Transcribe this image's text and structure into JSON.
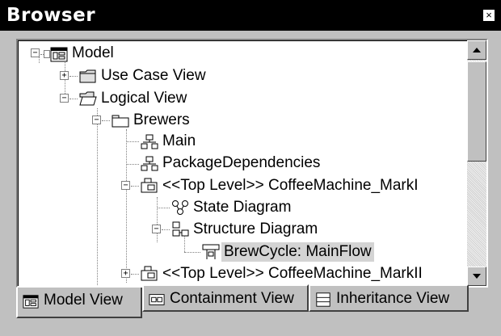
{
  "window": {
    "title": "Browser",
    "close_glyph": "×"
  },
  "tree": {
    "nodes": [
      {
        "label": "Model",
        "icon": "model-icon",
        "expanded": true
      },
      {
        "label": "Use Case View",
        "icon": "folder-closed-icon",
        "expanded": false
      },
      {
        "label": "Logical View",
        "icon": "folder-open-icon",
        "expanded": true
      },
      {
        "label": "Brewers",
        "icon": "package-folder-icon",
        "expanded": true
      },
      {
        "label": "Main",
        "icon": "class-diagram-icon"
      },
      {
        "label": "PackageDependencies",
        "icon": "class-diagram-icon"
      },
      {
        "label": "<<Top Level>> CoffeeMachine_MarkI",
        "icon": "capsule-icon",
        "expanded": true
      },
      {
        "label": "State Diagram",
        "icon": "state-diagram-icon"
      },
      {
        "label": "Structure Diagram",
        "icon": "structure-diagram-icon",
        "expanded": true
      },
      {
        "label": "BrewCycle: MainFlow",
        "icon": "capsule-role-icon",
        "selected": true
      },
      {
        "label": "<<Top Level>> CoffeeMachine_MarkII",
        "icon": "capsule-icon",
        "expanded": false
      }
    ]
  },
  "tabs": [
    {
      "label": "Model View",
      "icon": "model-view-icon",
      "active": true
    },
    {
      "label": "Containment View",
      "icon": "containment-view-icon",
      "active": false
    },
    {
      "label": "Inheritance View",
      "icon": "inheritance-view-icon",
      "active": false
    }
  ]
}
